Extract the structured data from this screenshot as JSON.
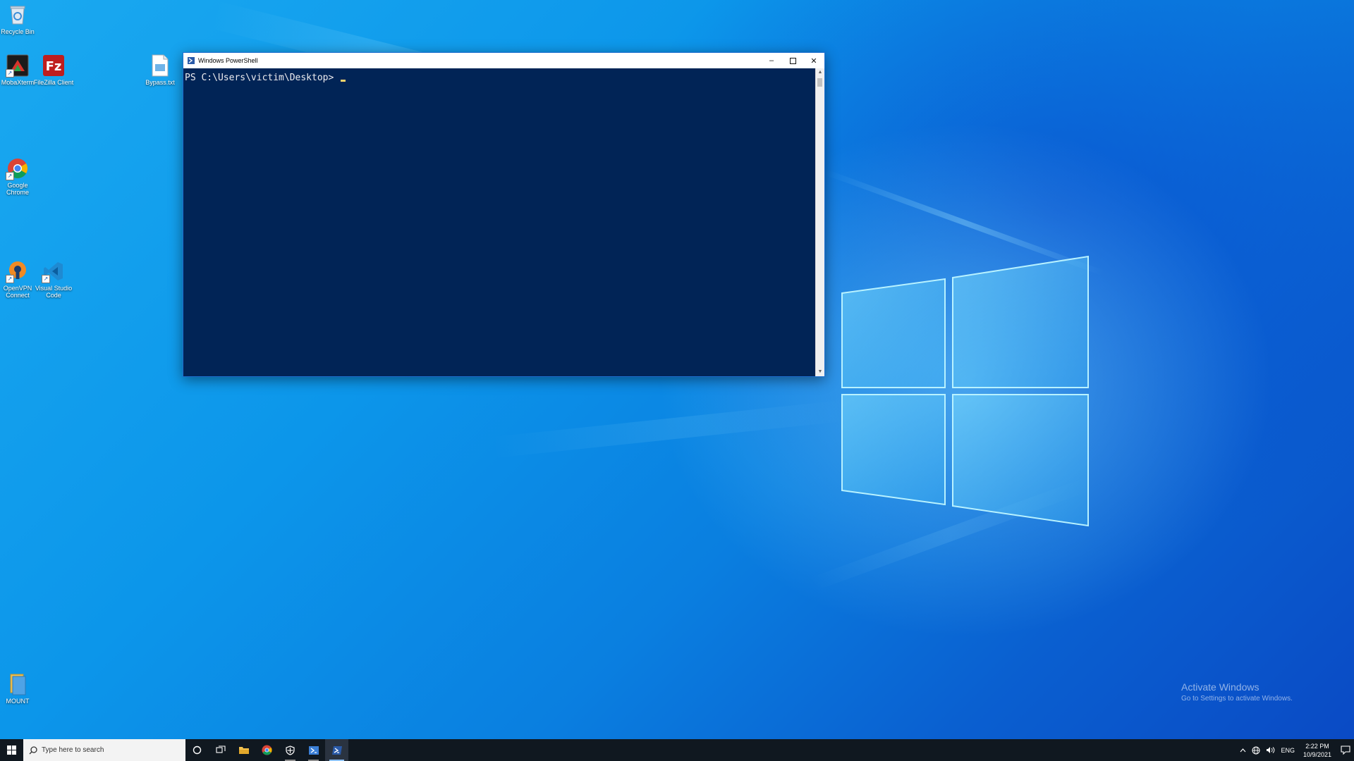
{
  "desktop": {
    "icons": [
      {
        "label": "Recycle Bin",
        "icon": "recycle-bin-icon"
      },
      {
        "label": "MobaXterm",
        "icon": "mobaxterm-icon"
      },
      {
        "label": "FileZilla Client",
        "icon": "filezilla-icon"
      },
      {
        "label": "Bypass.txt",
        "icon": "text-file-icon"
      },
      {
        "label": "Google Chrome",
        "icon": "chrome-icon"
      },
      {
        "label": "OpenVPN Connect",
        "icon": "openvpn-icon"
      },
      {
        "label": "Visual Studio Code",
        "icon": "vscode-icon"
      },
      {
        "label": "MOUNT",
        "icon": "folder-icon"
      }
    ],
    "watermark": {
      "title": "Activate Windows",
      "subtitle": "Go to Settings to activate Windows."
    }
  },
  "powershell": {
    "title": "Windows PowerShell",
    "prompt": "PS C:\\Users\\victim\\Desktop> ",
    "colors": {
      "background": "#012456",
      "text": "#eeedf0",
      "cursor": "#f4d36b"
    }
  },
  "taskbar": {
    "search_placeholder": "Type here to search",
    "language": "ENG",
    "time": "2:22 PM",
    "date": "10/9/2021",
    "apps": [
      "start-icon",
      "cortana-icon",
      "task-view-icon",
      "file-explorer-icon",
      "chrome-icon",
      "security-icon",
      "powershell-ise-icon",
      "powershell-icon"
    ]
  }
}
